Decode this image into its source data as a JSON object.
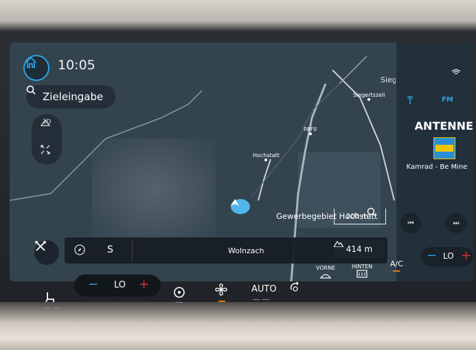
{
  "header": {
    "time": "10:05"
  },
  "search": {
    "label": "Zieleingabe"
  },
  "map_controls": {
    "view_label": "3D"
  },
  "map": {
    "places": [
      "Siegertszell",
      "PAFII",
      "Hochstatt"
    ],
    "top_label": "Siegertszell",
    "area_label": "Gewerbegebiet Hochstatt",
    "scale_label": "200 m"
  },
  "nav_bar": {
    "heading": "S",
    "street": "Wolnzach",
    "distance": "414 m"
  },
  "media": {
    "band": "FM",
    "station": "ANTENNE",
    "track": "Kamrad - Be Mine",
    "logo_text": "antenne bayern"
  },
  "climate": {
    "left_temp": "LO",
    "right_temp": "LO",
    "auto_label": "AUTO",
    "front_label": "VORNE",
    "rear_label": "HINTEN",
    "ac_label": "A/C"
  }
}
